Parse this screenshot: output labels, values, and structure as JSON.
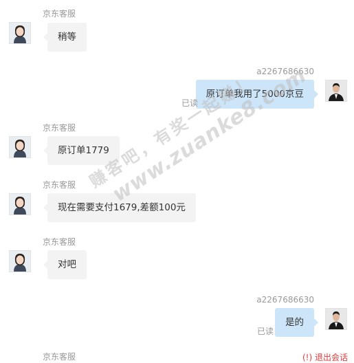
{
  "messages": [
    {
      "side": "left",
      "sender": "京东客服",
      "text": "稍等"
    },
    {
      "side": "right",
      "sender": "a2267686630",
      "text": "原订单我用了5000京豆",
      "status": "已读"
    },
    {
      "side": "left",
      "sender": "京东客服",
      "text": "原订单1779"
    },
    {
      "side": "left",
      "sender": "京东客服",
      "text": "现在需要支付1679,差额100元"
    },
    {
      "side": "left",
      "sender": "京东客服",
      "text": "对吧"
    },
    {
      "side": "right",
      "sender": "a2267686630",
      "text": "是的",
      "status": "已读"
    },
    {
      "side": "left",
      "sender": "京东客服",
      "text": ""
    }
  ],
  "watermark": {
    "line1": "赚客吧，有奖一起赚！",
    "line2": "www.zuanke8.com"
  },
  "exit_button": {
    "icon": "exit-icon",
    "label": "退出会话"
  },
  "colors": {
    "bubble_left": "#f3f3f3",
    "bubble_right": "#cde5f8",
    "exit": "#e4393c",
    "meta": "#999999"
  }
}
